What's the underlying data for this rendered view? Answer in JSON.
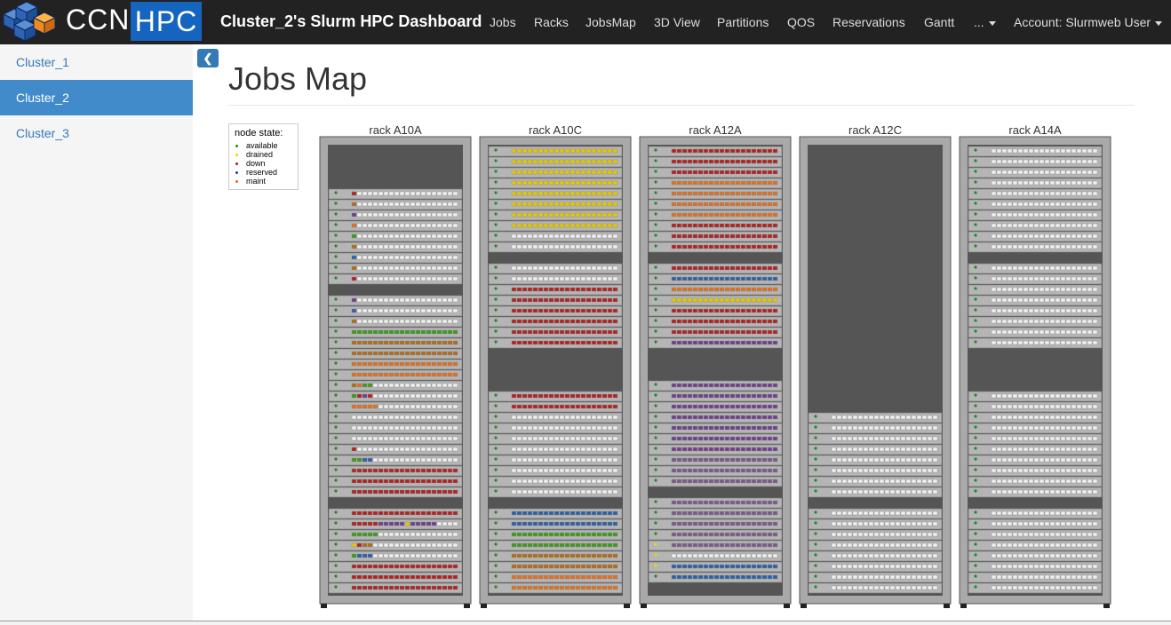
{
  "brand": {
    "ccn": "CCN",
    "hpc": "HPC"
  },
  "header": {
    "title": "Cluster_2's Slurm HPC Dashboard"
  },
  "nav": {
    "links": [
      "Jobs",
      "Racks",
      "JobsMap",
      "3D View",
      "Partitions",
      "QOS",
      "Reservations",
      "Gantt"
    ],
    "more": "...",
    "account": "Account: Slurmweb User"
  },
  "sidebar": {
    "items": [
      "Cluster_1",
      "Cluster_2",
      "Cluster_3"
    ],
    "active": "Cluster_2"
  },
  "page": {
    "title": "Jobs Map"
  },
  "legend": {
    "title": "node state:",
    "states": [
      {
        "label": "available",
        "color": "#1a8f1a"
      },
      {
        "label": "drained",
        "color": "#e8d800"
      },
      {
        "label": "down",
        "color": "#cc1111"
      },
      {
        "label": "reserved",
        "color": "#1f3fa8"
      },
      {
        "label": "maint",
        "color": "#e86a1a"
      }
    ]
  },
  "job_colors": {
    "R": "#b22222",
    "Y": "#e6c800",
    "O": "#e07020",
    "B": "#2e5fa8",
    "P": "#6e3f8e",
    "L": "#7a5a8a",
    "G": "#3e9a1e",
    "N": "#b36b1a",
    "E": "#f0f0f0"
  },
  "racks": [
    {
      "name": "rack A10A",
      "nodes": [
        "X",
        "X",
        "X",
        "X",
        "X",
        "X",
        "X",
        "X",
        "X",
        "X",
        "X",
        "X",
        "X",
        "X",
        "X",
        "X",
        "X",
        "X",
        "X",
        "X",
        "X",
        "X",
        "X",
        "X",
        "X",
        "X",
        "X",
        "X",
        "X",
        "X",
        "X",
        "X",
        "X",
        "X",
        "X",
        "X",
        "X",
        "X",
        "X",
        "X",
        "X",
        "X",
        "X",
        "X"
      ]
    },
    {
      "name": "rack A10C",
      "nodes": []
    },
    {
      "name": "rack A12A",
      "nodes": []
    },
    {
      "name": "rack A12C",
      "nodes": []
    },
    {
      "name": "rack A14A",
      "nodes": []
    }
  ]
}
